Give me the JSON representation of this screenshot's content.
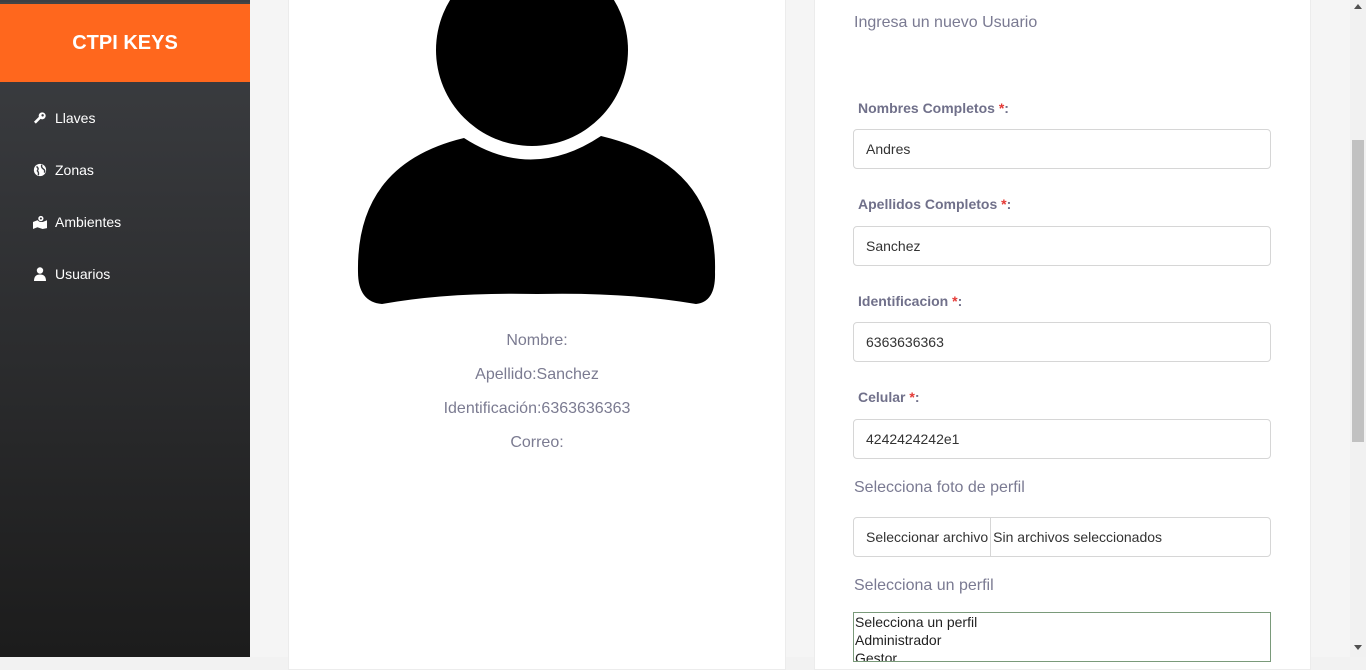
{
  "sidebar": {
    "brand": "CTPI KEYS",
    "brand_color": "#ff671d",
    "items": [
      {
        "label": "Llaves",
        "icon": "key-icon"
      },
      {
        "label": "Zonas",
        "icon": "globe-icon"
      },
      {
        "label": "Ambientes",
        "icon": "map-marker-icon"
      },
      {
        "label": "Usuarios",
        "icon": "user-icon"
      }
    ]
  },
  "profile": {
    "avatar_icon": "user-silhouette-icon",
    "nombre": "Nombre:",
    "apellido": "Apellido:Sanchez",
    "identificacion": "Identificación:6363636363",
    "correo": "Correo:"
  },
  "form": {
    "title": "Ingresa un nuevo Usuario",
    "fields": [
      {
        "label": "Nombres Completos ",
        "required": "*",
        "colon": ":",
        "value": "Andres"
      },
      {
        "label": "Apellidos Completos ",
        "required": "*",
        "colon": ":",
        "value": "Sanchez"
      },
      {
        "label": "Identificacion ",
        "required": "*",
        "colon": ":",
        "value": "6363636363"
      },
      {
        "label": "Celular ",
        "required": "*",
        "colon": ":",
        "value": "4242424242e1"
      }
    ],
    "photo_label": "Selecciona foto de perfil",
    "file_button": "Seleccionar archivo",
    "file_status": "Sin archivos seleccionados",
    "profile_label": "Selecciona un perfil",
    "profile_options": [
      "Selecciona un perfil",
      "Administrador",
      "Gestor"
    ]
  }
}
